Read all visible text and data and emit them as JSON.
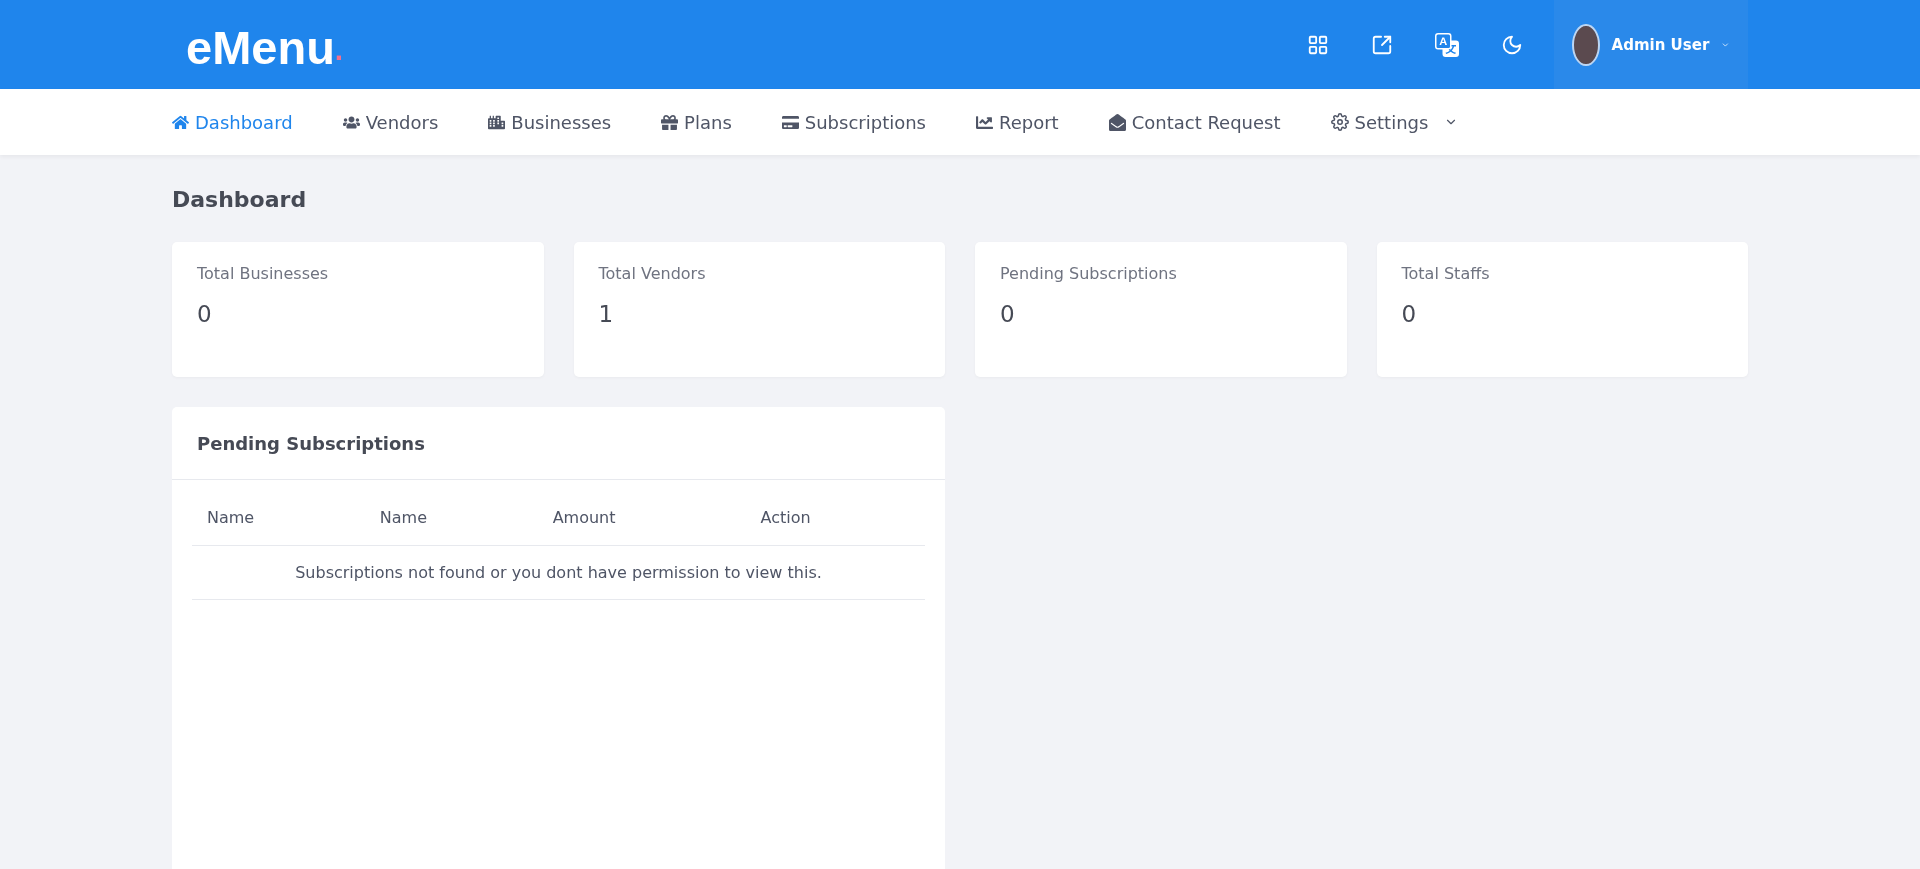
{
  "header": {
    "logo": "eMenu",
    "logo_dot": ".",
    "user": {
      "name": "Admin User"
    }
  },
  "nav": [
    {
      "label": "Dashboard",
      "selected": true
    },
    {
      "label": "Vendors",
      "selected": false
    },
    {
      "label": "Businesses",
      "selected": false
    },
    {
      "label": "Plans",
      "selected": false
    },
    {
      "label": "Subscriptions",
      "selected": false
    },
    {
      "label": "Report",
      "selected": false
    },
    {
      "label": "Contact Request",
      "selected": false
    },
    {
      "label": "Settings",
      "selected": false,
      "dropdown": true
    }
  ],
  "page_title": "Dashboard",
  "stats": [
    {
      "label": "Total Businesses",
      "value": "0"
    },
    {
      "label": "Total Vendors",
      "value": "1"
    },
    {
      "label": "Pending Subscriptions",
      "value": "0"
    },
    {
      "label": "Total Staffs",
      "value": "0"
    }
  ],
  "pending_subscriptions": {
    "title": "Pending Subscriptions",
    "columns": [
      "Name",
      "Name",
      "Amount",
      "Action"
    ],
    "empty_message": "Subscriptions not found or you dont have permission to view this."
  }
}
